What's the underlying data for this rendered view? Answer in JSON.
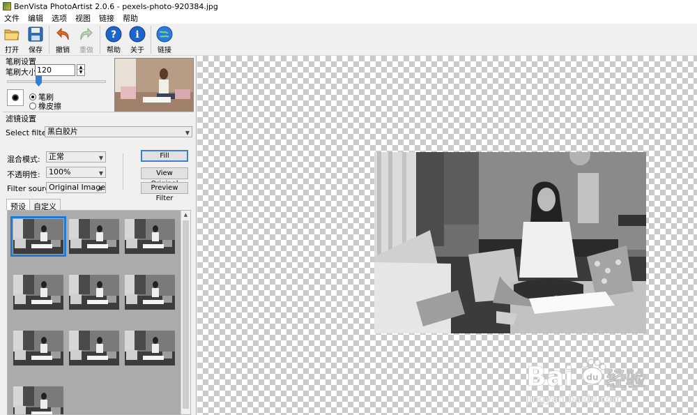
{
  "window": {
    "title": "BenVista PhotoArtist 2.0.6 - pexels-photo-920384.jpg"
  },
  "menu": [
    "文件",
    "编辑",
    "选项",
    "视图",
    "链接",
    "帮助"
  ],
  "toolbar": {
    "open": "打开",
    "save": "保存",
    "undo": "撤销",
    "redo": "重做",
    "help": "帮助",
    "about": "关于",
    "link": "链接"
  },
  "brush": {
    "group_title": "笔刷设置",
    "size_label": "笔刷大小:",
    "size_value": "120",
    "mode_brush": "笔刷",
    "mode_eraser": "橡皮擦"
  },
  "filter": {
    "group_title": "滤镜设置",
    "select_label": "Select filter:",
    "selected": "黑白胶片",
    "blend_label": "混合模式:",
    "blend_value": "正常",
    "opacity_label": "不透明性:",
    "opacity_value": "100%",
    "source_label": "Filter source:",
    "source_value": "Original Image",
    "fill_btn": "Fill",
    "view_original_btn": "View Original",
    "preview_filter_btn": "Preview Filter"
  },
  "tabs": {
    "preset": "预设",
    "custom": "自定义"
  },
  "watermark": {
    "brand_a": "Bai",
    "brand_b": "经验",
    "url": "jingyan.baidu.com"
  },
  "colors": {
    "accent": "#1e7ad8",
    "checker": "#cbcbcb"
  }
}
